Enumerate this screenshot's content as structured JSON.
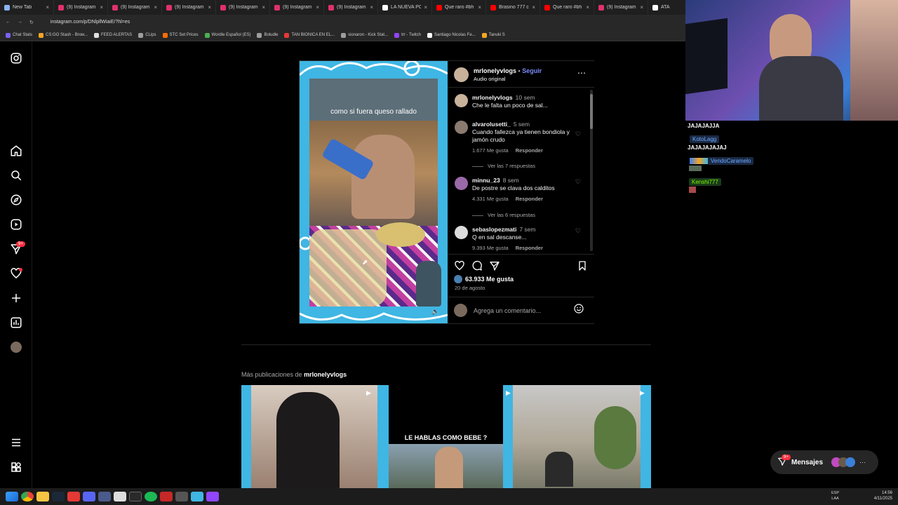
{
  "browser": {
    "tabs": [
      {
        "label": "New Tab",
        "color": "#8ab4f8"
      },
      {
        "label": "(9) Instagram",
        "color": "#e1306c"
      },
      {
        "label": "(9) Instagram",
        "color": "#e1306c"
      },
      {
        "label": "(9) Instagram",
        "color": "#e1306c"
      },
      {
        "label": "(9) Instagram",
        "color": "#e1306c"
      },
      {
        "label": "(9) Instagram",
        "color": "#e1306c"
      },
      {
        "label": "(9) Instagram",
        "color": "#e1306c"
      },
      {
        "label": "LA NUEVA PC",
        "color": "#ffffff"
      },
      {
        "label": "Que raro #bh",
        "color": "#ff0000"
      },
      {
        "label": "Brasino 777 c",
        "color": "#ff0000"
      },
      {
        "label": "Que raro #bh",
        "color": "#ff0000"
      },
      {
        "label": "(9) Instagram",
        "color": "#e1306c"
      },
      {
        "label": "ATA",
        "color": "#ffffff"
      }
    ],
    "url": "instagram.com/p/DNlpllWiaiE/?hl=es",
    "bookmarks": [
      {
        "label": "Chat Stats",
        "color": "#7b61ff"
      },
      {
        "label": "CS:GO Stash - Brow...",
        "color": "#f5a623"
      },
      {
        "label": "FEED ALERTAS",
        "color": "#e0e0e0"
      },
      {
        "label": "CLips",
        "color": "#9e9e9e"
      },
      {
        "label": "STC Set Prices",
        "color": "#ff6d00"
      },
      {
        "label": "Wordle Español (ES)",
        "color": "#4caf50"
      },
      {
        "label": "Boludle",
        "color": "#9e9e9e"
      },
      {
        "label": "TAN BIONICA EN EL...",
        "color": "#e53935"
      },
      {
        "label": "sionaron - Kick Stat...",
        "color": "#9e9e9e"
      },
      {
        "label": "trr - Twitch",
        "color": "#9146ff"
      },
      {
        "label": "Santiago Nicolas Fe...",
        "color": "#ffffff"
      },
      {
        "label": "Tanuki S",
        "color": "#f5a623"
      }
    ]
  },
  "sidebar": {
    "notifications_badge": "9+"
  },
  "post": {
    "caption": "como si fuera queso rallado",
    "author": "mrlonelyvlogs",
    "follow_label": "Seguir",
    "audio": "Audio original",
    "comments": [
      {
        "user": "mrlonelyvlogs",
        "time": "10 sem",
        "text": "Che le falta un poco de sal...",
        "likes": "",
        "reply": ""
      },
      {
        "user": "alvarolusetti_",
        "time": "5 sem",
        "text": "Cuando fallezca ya tienen bondiola y jamón crudo",
        "likes": "1.677 Me gusta",
        "reply": "Responder",
        "replies": "Ver las 7 respuestas"
      },
      {
        "user": "minnu_23",
        "time": "8 sem",
        "text": "De postre se clava dos calditos",
        "likes": "4.331 Me gusta",
        "reply": "Responder",
        "replies": "Ver las 6 respuestas"
      },
      {
        "user": "sebaslopezmati",
        "time": "7 sem",
        "text": "Q en sal descanse...",
        "likes": "9.393 Me gusta",
        "reply": "Responder"
      }
    ],
    "likes": "63.933 Me gusta",
    "date": "20 de agosto",
    "comment_placeholder": "Agrega un comentario..."
  },
  "more": {
    "prefix": "Más publicaciones de",
    "author": "mrlonelyvlogs",
    "thumb_text": "LE HABLAS COMO BEBE ?"
  },
  "stream_chat": [
    {
      "kind": "text",
      "text": "JAJAJAJJA"
    },
    {
      "kind": "name",
      "text": "KotoLagg",
      "color": "#6fa8ff"
    },
    {
      "kind": "text",
      "text": "JAJAJAJAJAJ"
    },
    {
      "kind": "name",
      "text": "VendoCaramelo",
      "color": "#6fa8ff"
    },
    {
      "kind": "name",
      "text": "Kenshi777",
      "color": "#7cfc00"
    }
  ],
  "messages": {
    "label": "Mensajes",
    "badge": "9+"
  },
  "taskbar": {
    "lang_top": "ESP",
    "lang_bottom": "LAA",
    "time": "14:56",
    "date": "4/11/2025"
  }
}
